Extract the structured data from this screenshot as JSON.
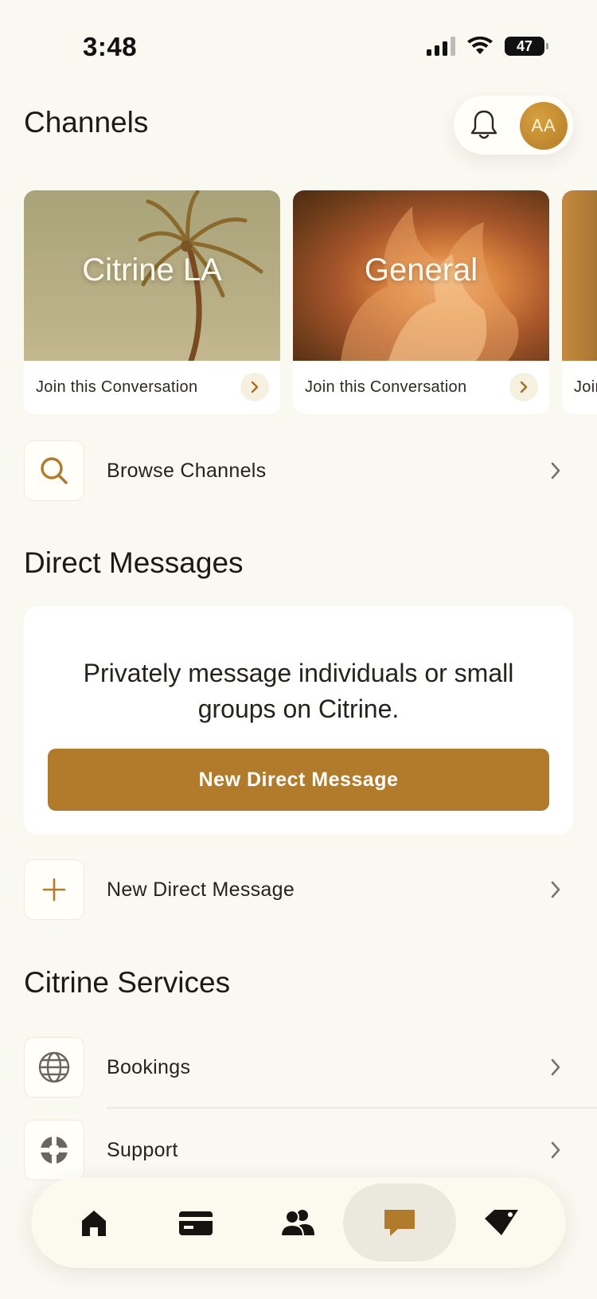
{
  "status_bar": {
    "time": "3:48",
    "battery": "47"
  },
  "header": {
    "title": "Channels",
    "avatar_initials": "AA"
  },
  "channels": [
    {
      "title": "Citrine LA",
      "cta": "Join this Conversation"
    },
    {
      "title": "General",
      "cta": "Join this Conversation"
    },
    {
      "title": "",
      "cta": "Join this Conversation"
    }
  ],
  "browse_channels": {
    "label": "Browse Channels"
  },
  "direct_messages": {
    "title": "Direct Messages",
    "description": "Privately message individuals or small groups on Citrine.",
    "button_label": "New Direct Message",
    "row_label": "New Direct Message"
  },
  "services": {
    "title": "Citrine Services",
    "items": [
      {
        "label": "Bookings",
        "icon": "globe-icon"
      },
      {
        "label": "Support",
        "icon": "lifebuoy-icon"
      }
    ]
  },
  "tab_bar": {
    "tabs": [
      {
        "icon": "home-icon",
        "active": false
      },
      {
        "icon": "card-icon",
        "active": false
      },
      {
        "icon": "people-icon",
        "active": false
      },
      {
        "icon": "chat-icon",
        "active": true
      },
      {
        "icon": "diamond-tag-icon",
        "active": false
      }
    ]
  },
  "colors": {
    "accent": "#b27b2b",
    "background": "#f9f8f1",
    "card": "#ffffff",
    "text": "#1f1c17"
  }
}
